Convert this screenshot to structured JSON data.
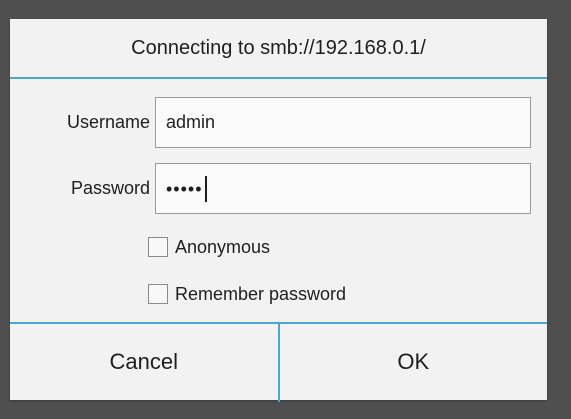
{
  "dialog": {
    "title": "Connecting to smb://192.168.0.1/",
    "username_label": "Username",
    "username_value": "admin",
    "password_label": "Password",
    "password_value": "•••••",
    "anonymous_label": "Anonymous",
    "anonymous_checked": false,
    "remember_label": "Remember password",
    "remember_checked": false,
    "cancel_label": "Cancel",
    "ok_label": "OK"
  },
  "colors": {
    "accent": "#47a8d6",
    "background": "#4f4f4f",
    "dialog": "#f2f2f2"
  }
}
